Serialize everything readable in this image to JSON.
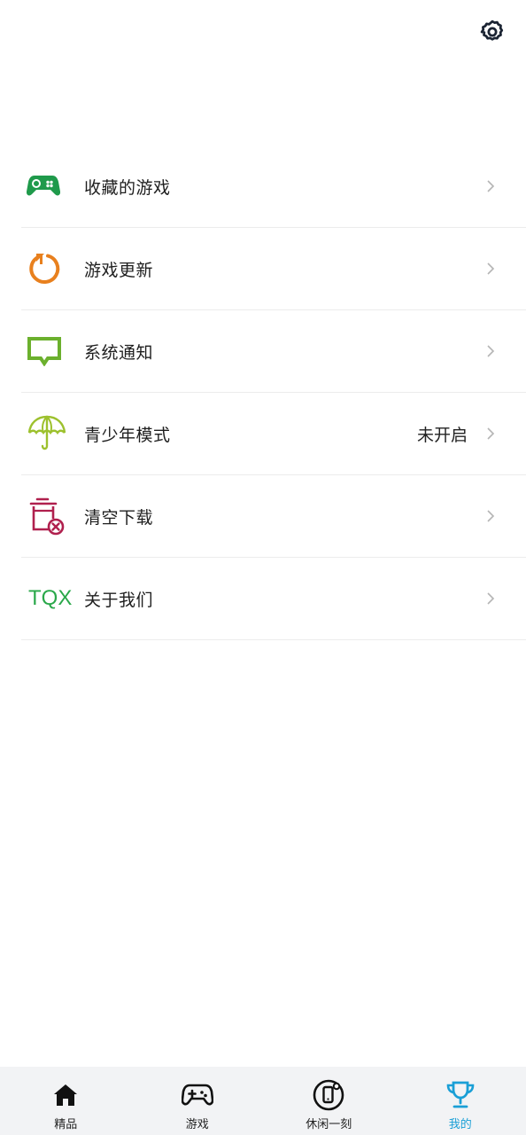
{
  "header": {
    "settings_icon": "gear-icon"
  },
  "menu": [
    {
      "label": "收藏的游戏",
      "icon": "gamepad-icon",
      "value": ""
    },
    {
      "label": "游戏更新",
      "icon": "refresh-icon",
      "value": ""
    },
    {
      "label": "系统通知",
      "icon": "message-icon",
      "value": ""
    },
    {
      "label": "青少年模式",
      "icon": "umbrella-icon",
      "value": "未开启"
    },
    {
      "label": "清空下载",
      "icon": "trash-clear-icon",
      "value": ""
    },
    {
      "label": "关于我们",
      "icon": "tqx-logo",
      "logo_text": "TQX",
      "value": ""
    }
  ],
  "tabbar": {
    "tabs": [
      {
        "label": "精品",
        "icon": "home-icon"
      },
      {
        "label": "游戏",
        "icon": "gamepad-icon"
      },
      {
        "label": "休闲一刻",
        "icon": "phone-icon"
      },
      {
        "label": "我的",
        "icon": "trophy-icon"
      }
    ],
    "active_index": 3
  },
  "colors": {
    "accent": "#1a9fd6",
    "gamepad_green": "#1f9a4b",
    "refresh_orange": "#e8801e",
    "message_green": "#6bb02d",
    "umbrella_green": "#9dc12e",
    "trash_red": "#b0204e",
    "tqx_green": "#2aa84a"
  }
}
